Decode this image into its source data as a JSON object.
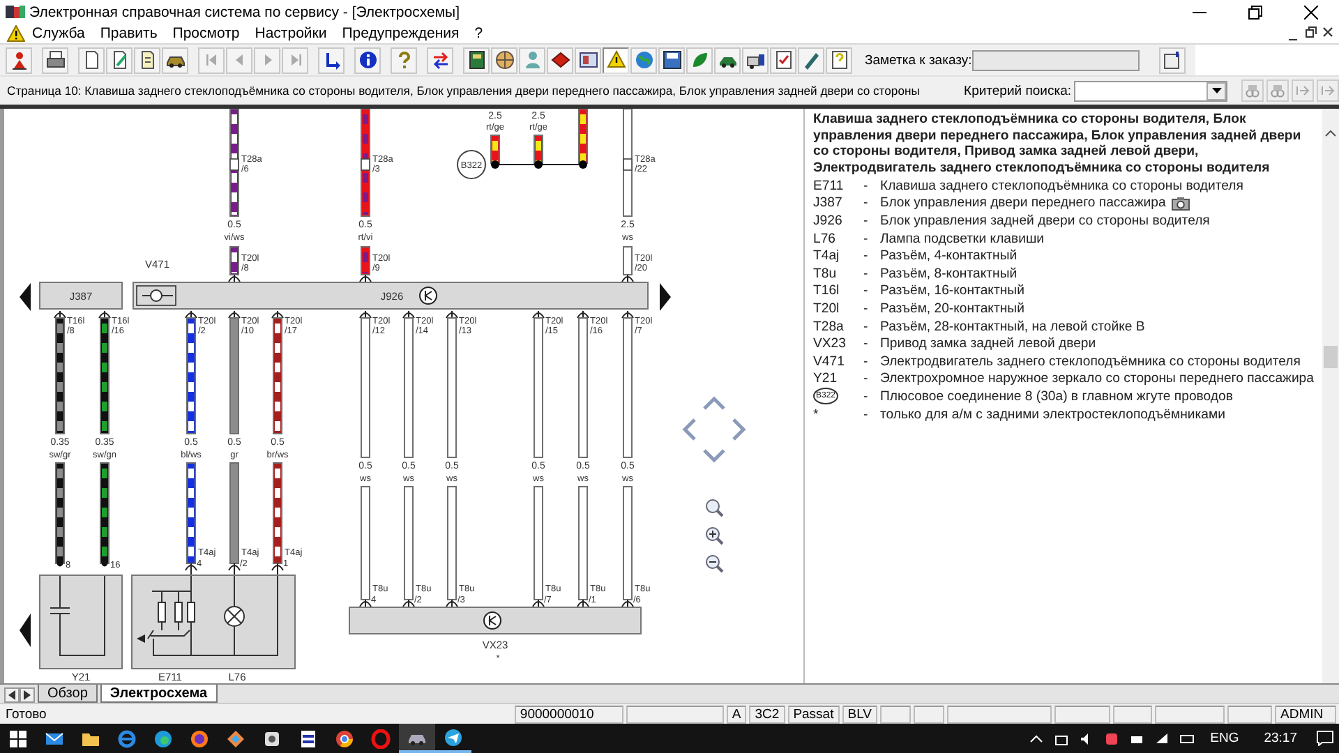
{
  "window": {
    "title": "Электронная справочная система по сервису - [Электросхемы]"
  },
  "menu": [
    "Служба",
    "Править",
    "Просмотр",
    "Настройки",
    "Предупреждения",
    "?"
  ],
  "toolbar": {
    "note_label": "Заметка к заказу:"
  },
  "page_bar": {
    "title": "Страница 10: Клавиша заднего стеклоподъёмника со стороны водителя, Блок управления двери переднего пассажира, Блок управления задней двери со стороны",
    "search_label": "Критерий поиска:"
  },
  "diagram": {
    "top_wires": [
      {
        "upper_connector": "T28a",
        "upper_pin": "/6",
        "gauge": "0.5",
        "wire_color": "vi/ws",
        "connector": "T20l",
        "pin": "/8",
        "color": "#7b1c8c",
        "stripe": {
          "color": "#ffffff"
        }
      },
      {
        "upper_connector": "T28a",
        "upper_pin": "/3",
        "gauge": "0.5",
        "wire_color": "rt/vi",
        "connector": "T20l",
        "pin": "/9",
        "color": "#e8141b",
        "stripe": {
          "color": "#7b1c8c"
        }
      },
      {
        "upper_connector": "T28a",
        "upper_pin": "/22",
        "gauge": "2.5",
        "wire_color": "ws",
        "connector": "T20l",
        "pin": "/20",
        "color": "#ffffff"
      }
    ],
    "splice": {
      "label": "B322",
      "wires": [
        {
          "gauge": "2.5",
          "wire_color": "rt/ge",
          "color": "#e8141b",
          "stripe": {
            "color": "#f5e616"
          }
        },
        {
          "gauge": "2.5",
          "wire_color": "rt/ge",
          "color": "#e8141b",
          "stripe": {
            "color": "#f5e616"
          }
        },
        {
          "color": "#e8141b",
          "stripe": {
            "color": "#f5e616"
          }
        }
      ]
    },
    "components": [
      {
        "label": "J387"
      },
      {
        "label": "V471"
      },
      {
        "label": "J926"
      },
      {
        "label": "Y21"
      },
      {
        "label": "E711"
      },
      {
        "label": "L76"
      },
      {
        "label": "VX23",
        "note": "*"
      }
    ],
    "bottom_wires": [
      {
        "kind": "pin",
        "connector": "T16l",
        "pin": "/8",
        "gauge": "0.35",
        "wire_color": "sw/gr",
        "end_pin": "8",
        "color": "#111111",
        "stripe": {
          "color": "#8c8c8c"
        }
      },
      {
        "kind": "pin",
        "connector": "T16l",
        "pin": "/16",
        "gauge": "0.35",
        "wire_color": "sw/gn",
        "end_pin": "16",
        "color": "#111111",
        "stripe": {
          "color": "#1e9e2e"
        }
      },
      {
        "kind": "connector",
        "connector": "T20l",
        "pin": "/2",
        "gauge": "0.5",
        "wire_color": "bl/ws",
        "end_connector": "T4aj",
        "end_pin": "4",
        "color": "#1530e0",
        "stripe": {
          "color": "#ffffff"
        }
      },
      {
        "kind": "connector",
        "connector": "T20l",
        "pin": "/10",
        "gauge": "0.5",
        "wire_color": "gr",
        "end_connector": "T4aj",
        "end_pin": "/2",
        "color": "#8c8c8c"
      },
      {
        "kind": "connector",
        "connector": "T20l",
        "pin": "/17",
        "gauge": "0.5",
        "wire_color": "br/ws",
        "end_connector": "T4aj",
        "end_pin": "1",
        "color": "#a3201f",
        "stripe": {
          "color": "#ffffff"
        }
      },
      {
        "kind": "connector",
        "connector": "T20l",
        "pin": "/12",
        "gauge": "0.5",
        "wire_color": "ws",
        "end_connector": "T8u",
        "end_pin": "4",
        "color": "#ffffff"
      },
      {
        "kind": "connector",
        "connector": "T20l",
        "pin": "/14",
        "gauge": "0.5",
        "wire_color": "ws",
        "end_connector": "T8u",
        "end_pin": "/2",
        "color": "#ffffff"
      },
      {
        "kind": "connector",
        "connector": "T20l",
        "pin": "/13",
        "gauge": "0.5",
        "wire_color": "ws",
        "end_connector": "T8u",
        "end_pin": "/3",
        "color": "#ffffff"
      },
      {
        "kind": "connector",
        "connector": "T20l",
        "pin": "/15",
        "gauge": "0.5",
        "wire_color": "ws",
        "end_connector": "T8u",
        "end_pin": "/7",
        "color": "#ffffff"
      },
      {
        "kind": "connector",
        "connector": "T20l",
        "pin": "/16",
        "gauge": "0.5",
        "wire_color": "ws",
        "end_connector": "T8u",
        "end_pin": "/1",
        "color": "#ffffff"
      },
      {
        "kind": "connector",
        "connector": "T20l",
        "pin": "/7",
        "gauge": "0.5",
        "wire_color": "ws",
        "end_connector": "T8u",
        "end_pin": "/6",
        "color": "#ffffff"
      }
    ]
  },
  "legend": {
    "title": "Клавиша заднего стеклоподъёмника со стороны водителя, Блок управления двери переднего пассажира, Блок управления задней двери со стороны водителя, Привод замка задней левой двери, Электродвигатель заднего стеклоподъёмника со стороны водителя",
    "items": [
      {
        "kind": "code",
        "code": "E711",
        "dash": "-",
        "text": "Клавиша заднего стеклоподъёмника со стороны водителя",
        "camera": false
      },
      {
        "kind": "code",
        "code": "J387",
        "dash": "-",
        "text": "Блок управления двери переднего пассажира",
        "camera": true
      },
      {
        "kind": "code",
        "code": "J926",
        "dash": "-",
        "text": "Блок управления задней двери со стороны водителя",
        "camera": false
      },
      {
        "kind": "code",
        "code": "L76",
        "dash": "-",
        "text": "Лампа подсветки клавиши",
        "camera": false
      },
      {
        "kind": "code",
        "code": "T4aj",
        "dash": "-",
        "text": "Разъём, 4-контактный",
        "camera": false
      },
      {
        "kind": "code",
        "code": "T8u",
        "dash": "-",
        "text": "Разъём, 8-контактный",
        "camera": false
      },
      {
        "kind": "code",
        "code": "T16l",
        "dash": "-",
        "text": "Разъём, 16-контактный",
        "camera": false
      },
      {
        "kind": "code",
        "code": "T20l",
        "dash": "-",
        "text": "Разъём, 20-контактный",
        "camera": false
      },
      {
        "kind": "code",
        "code": "T28a",
        "dash": "-",
        "text": "Разъём, 28-контактный, на левой стойке B",
        "camera": false
      },
      {
        "kind": "code",
        "code": "VX23",
        "dash": "-",
        "text": "Привод замка задней левой двери",
        "camera": false
      },
      {
        "kind": "code",
        "code": "V471",
        "dash": "-",
        "text": "Электродвигатель заднего стеклоподъёмника со стороны водителя",
        "camera": false
      },
      {
        "kind": "code",
        "code": "Y21",
        "dash": "-",
        "text": "Электрохромное наружное зеркало со стороны переднего пассажира",
        "camera": false
      },
      {
        "kind": "splice",
        "code": "B322",
        "dash": "-",
        "text": "Плюсовое соединение 8 (30a) в главном жгуте проводов",
        "camera": false
      },
      {
        "kind": "code",
        "code": "*",
        "dash": "-",
        "text": "только для а/м с задними электростеклоподъёмниками",
        "camera": false
      }
    ]
  },
  "tabs": [
    {
      "label": "Обзор",
      "selected": false
    },
    {
      "label": "Электросхема",
      "selected": true
    }
  ],
  "status_bar": {
    "message": "Готово",
    "order": "9000000010",
    "codes": [
      "A",
      "3C2",
      "Passat",
      "BLV"
    ],
    "user": "ADMIN"
  },
  "taskbar": {
    "apps": [
      {
        "kind": "mail",
        "running": false,
        "selected": false
      },
      {
        "kind": "folder",
        "running": false,
        "selected": false
      },
      {
        "kind": "ie",
        "running": false,
        "selected": false
      },
      {
        "kind": "edge",
        "running": false,
        "selected": false
      },
      {
        "kind": "firefox",
        "running": false,
        "selected": false
      },
      {
        "kind": "diamond",
        "running": false,
        "selected": false
      },
      {
        "kind": "tool",
        "running": false,
        "selected": false
      },
      {
        "kind": "doc",
        "running": false,
        "selected": false
      },
      {
        "kind": "chrome",
        "running": false,
        "selected": false
      },
      {
        "kind": "opera",
        "running": false,
        "selected": false
      },
      {
        "kind": "car",
        "running": true,
        "selected": true
      },
      {
        "kind": "telegram",
        "running": true,
        "selected": false
      }
    ],
    "language": "ENG",
    "time": "23:17"
  }
}
